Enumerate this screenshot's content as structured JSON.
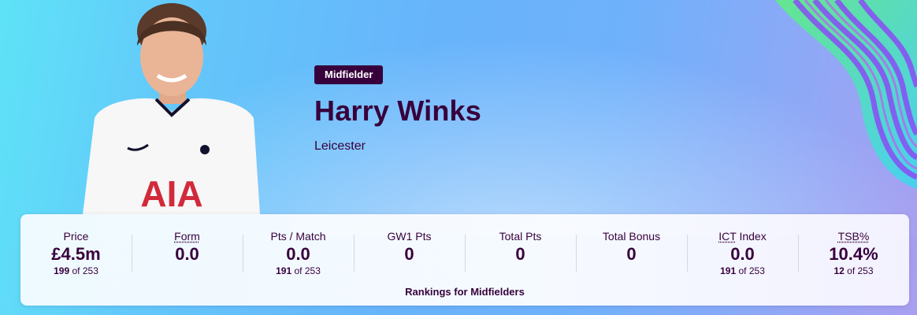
{
  "player": {
    "position": "Midfielder",
    "name": "Harry Winks",
    "team": "Leicester",
    "shirt_sponsor": "AIA",
    "photo_icon": "player-photo"
  },
  "stats": [
    {
      "key": "price",
      "label": "Price",
      "value": "£4.5m",
      "rank": "199",
      "rank_of": "of 253"
    },
    {
      "key": "form",
      "label": "Form",
      "value": "0.0",
      "rank": "",
      "rank_of": ""
    },
    {
      "key": "pts-per-match",
      "label": "Pts / Match",
      "value": "0.0",
      "rank": "191",
      "rank_of": "of 253"
    },
    {
      "key": "gw1-pts",
      "label": "GW1 Pts",
      "value": "0",
      "rank": "",
      "rank_of": ""
    },
    {
      "key": "total-pts",
      "label": "Total Pts",
      "value": "0",
      "rank": "",
      "rank_of": ""
    },
    {
      "key": "total-bonus",
      "label": "Total Bonus",
      "value": "0",
      "rank": "",
      "rank_of": ""
    },
    {
      "key": "ict-index",
      "label_abbr": "ICT",
      "label_rest": " Index",
      "value": "0.0",
      "rank": "191",
      "rank_of": "of 253"
    },
    {
      "key": "tsb",
      "label_abbr": "TSB%",
      "value": "10.4%",
      "rank": "12",
      "rank_of": "of 253"
    }
  ],
  "rankings_caption": "Rankings for Midfielders",
  "colors": {
    "brand_purple": "#37003c",
    "accent_green": "#5ff07e",
    "accent_violet": "#8a4cf6"
  }
}
